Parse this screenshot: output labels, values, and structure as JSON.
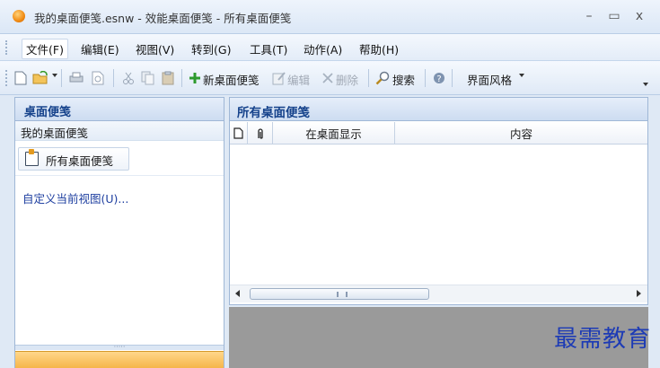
{
  "window": {
    "title": "我的桌面便笺.esnw - 效能桌面便笺 - 所有桌面便笺"
  },
  "menu": [
    {
      "label": "文件(F)"
    },
    {
      "label": "编辑(E)"
    },
    {
      "label": "视图(V)"
    },
    {
      "label": "转到(G)"
    },
    {
      "label": "工具(T)"
    },
    {
      "label": "动作(A)"
    },
    {
      "label": "帮助(H)"
    }
  ],
  "toolbar": {
    "new_note_label": "新桌面便笺",
    "edit_label": "编辑",
    "delete_label": "删除",
    "search_label": "搜索",
    "theme_label": "界面风格"
  },
  "left_pane": {
    "header": "桌面便笺",
    "group_label": "我的桌面便笺",
    "nav_item": "所有桌面便笺",
    "custom_view_link": "自定义当前视图(U)..."
  },
  "right_pane": {
    "header": "所有桌面便笺",
    "columns": {
      "show_on_desktop": "在桌面显示",
      "content": "内容"
    }
  },
  "watermark": "最需教育",
  "colors": {
    "accent": "#15428b",
    "link": "#1e3fa0",
    "selected_tab": "#f5b346"
  }
}
